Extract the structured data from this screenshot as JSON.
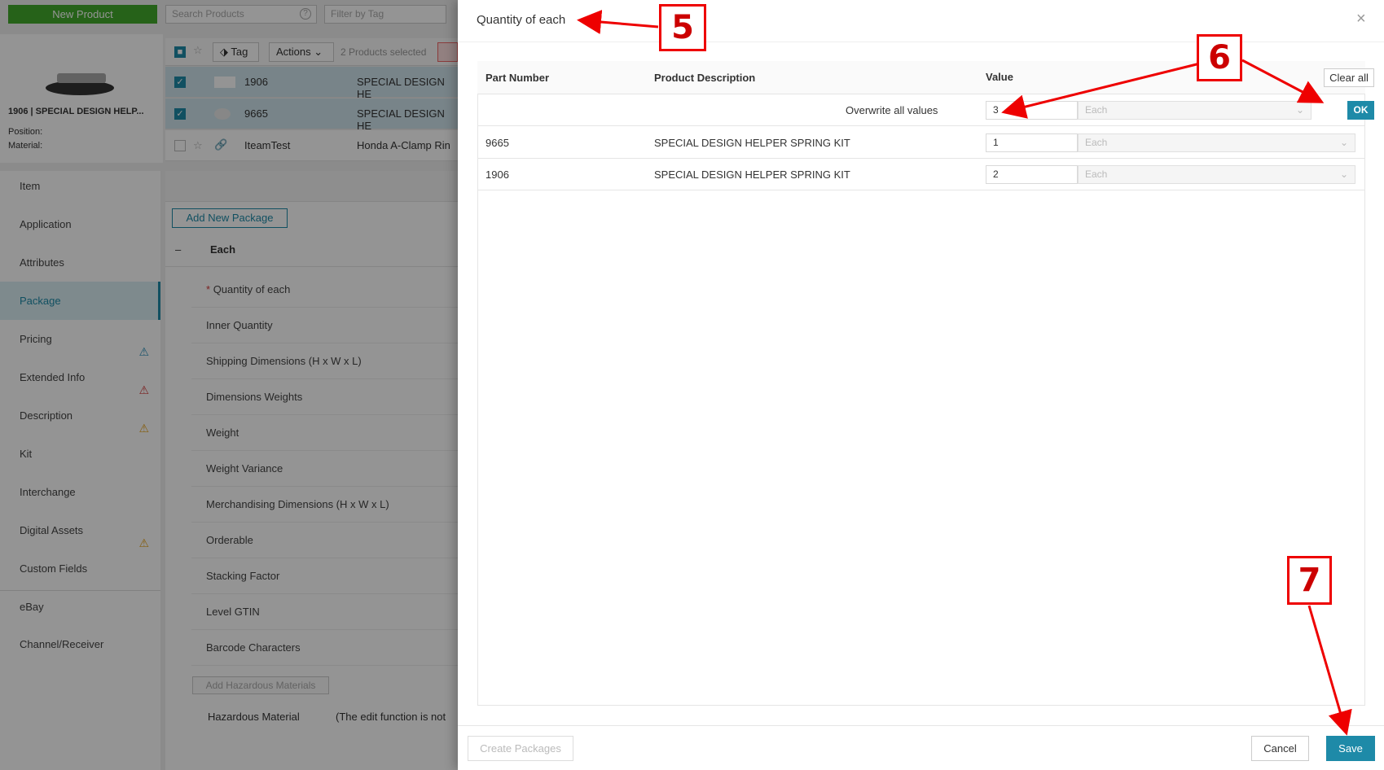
{
  "background": {
    "new_product": "New Product",
    "search_placeholder": "Search Products",
    "filter_placeholder": "Filter by Tag",
    "product_title": "1906 | SPECIAL DESIGN HELP...",
    "meta": [
      "Position:",
      "Material:"
    ],
    "toolbar": {
      "tag": "Tag",
      "actions": "Actions",
      "selected": "2 Products selected"
    },
    "rows": [
      {
        "part": "1906",
        "desc": "SPECIAL DESIGN HE",
        "selected": true
      },
      {
        "part": "9665",
        "desc": "SPECIAL DESIGN HE",
        "selected": true
      },
      {
        "part": "IteamTest",
        "desc": "Honda A-Clamp Rin",
        "selected": false
      }
    ],
    "nav": [
      {
        "label": "Item",
        "warn": ""
      },
      {
        "label": "Application",
        "warn": ""
      },
      {
        "label": "Attributes",
        "warn": ""
      },
      {
        "label": "Package",
        "warn": "",
        "active": true
      },
      {
        "label": "Pricing",
        "warn": "#2a8fb8"
      },
      {
        "label": "Extended Info",
        "warn": "#d43a3a"
      },
      {
        "label": "Description",
        "warn": "#e6a21a"
      },
      {
        "label": "Kit",
        "warn": ""
      },
      {
        "label": "Interchange",
        "warn": ""
      },
      {
        "label": "Digital Assets",
        "warn": "#e6a21a"
      },
      {
        "label": "Custom Fields",
        "warn": ""
      },
      {
        "label": "eBay",
        "warn": ""
      },
      {
        "label": "Channel/Receiver",
        "warn": ""
      }
    ],
    "add_package": "Add New Package",
    "collapse": "–",
    "section": "Each",
    "required_mark": "*",
    "fields": [
      "Quantity of each",
      "Inner Quantity",
      "Shipping Dimensions (H x W x L)",
      "Dimensions Weights",
      "Weight",
      "Weight Variance",
      "Merchandising Dimensions (H x W x L)",
      "Orderable",
      "Stacking Factor",
      "Level GTIN",
      "Barcode Characters"
    ],
    "add_hazard": "Add Hazardous Materials",
    "hazard_label": "Hazardous Material",
    "hazard_note": "(The edit function is not"
  },
  "modal": {
    "title": "Quantity of each",
    "close_icon": "×",
    "headers": {
      "part": "Part Number",
      "desc": "Product Description",
      "value": "Value"
    },
    "clear_all": "Clear all",
    "overwrite_label": "Overwrite all values",
    "overwrite_value": "3",
    "unit_placeholder": "Each",
    "ok": "OK",
    "rows": [
      {
        "part": "9665",
        "desc": "SPECIAL DESIGN HELPER SPRING KIT",
        "value": "1",
        "unit": "Each"
      },
      {
        "part": "1906",
        "desc": "SPECIAL DESIGN HELPER SPRING KIT",
        "value": "2",
        "unit": "Each"
      }
    ],
    "create_packages": "Create Packages",
    "cancel": "Cancel",
    "save": "Save"
  },
  "annotations": [
    "5",
    "6",
    "7"
  ],
  "colors": {
    "accent": "#1e8aa8",
    "green": "#43a92b",
    "annotation": "#e00000"
  }
}
